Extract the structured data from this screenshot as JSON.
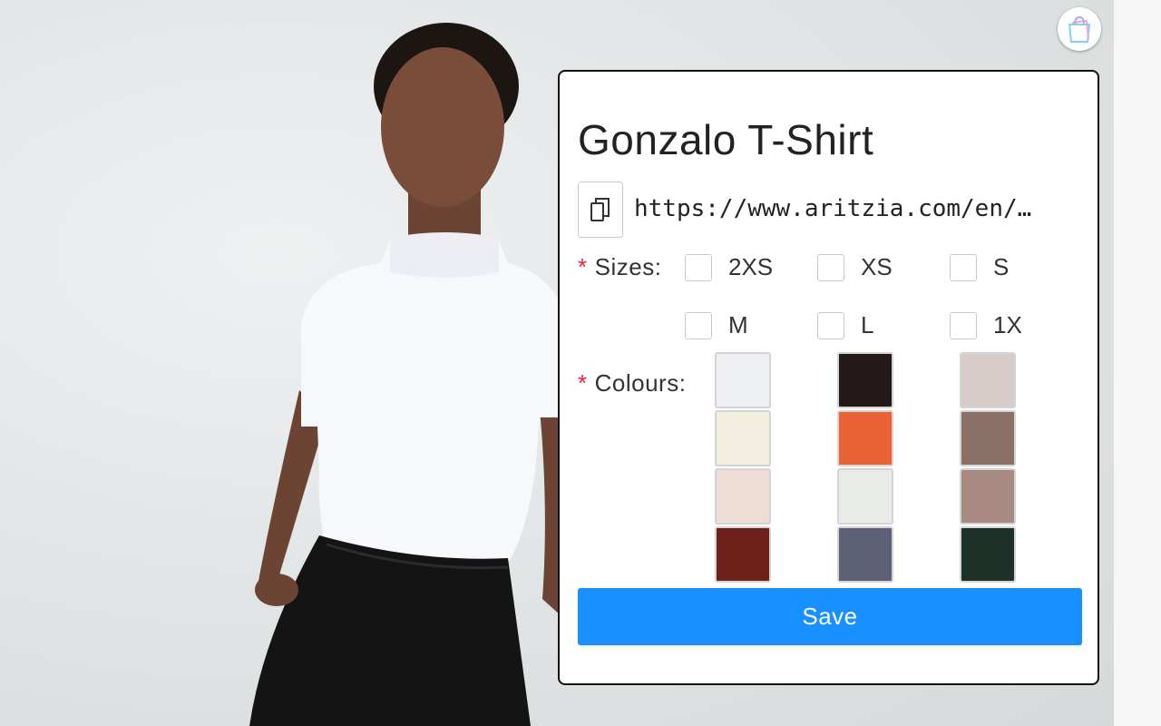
{
  "background": {
    "image": "model-in-white-mock-neck-tshirt-photo"
  },
  "extension": {
    "icon": "shopping-bag-icon"
  },
  "product": {
    "title": "Gonzalo T-Shirt",
    "url": "https://www.aritzia.com/en/…",
    "copy_icon": "copy-icon"
  },
  "sizes": {
    "label": "Sizes:",
    "required_mark": "*",
    "options": [
      "2XS",
      "XS",
      "S",
      "M",
      "L",
      "1X"
    ]
  },
  "colours": {
    "label": "Colours:",
    "required_mark": "*",
    "swatches": [
      "#eff0f3",
      "#241a19",
      "#d8cccb",
      "#f2efe0",
      "#ea6235",
      "#8b7068",
      "#efdcd5",
      "#e8ebe6",
      "#a98a83",
      "#6e1f1a",
      "#5d6077",
      "#1d3128"
    ]
  },
  "actions": {
    "save_label": "Save"
  },
  "theme": {
    "primary": "#1890ff",
    "required": "#f5222d"
  }
}
